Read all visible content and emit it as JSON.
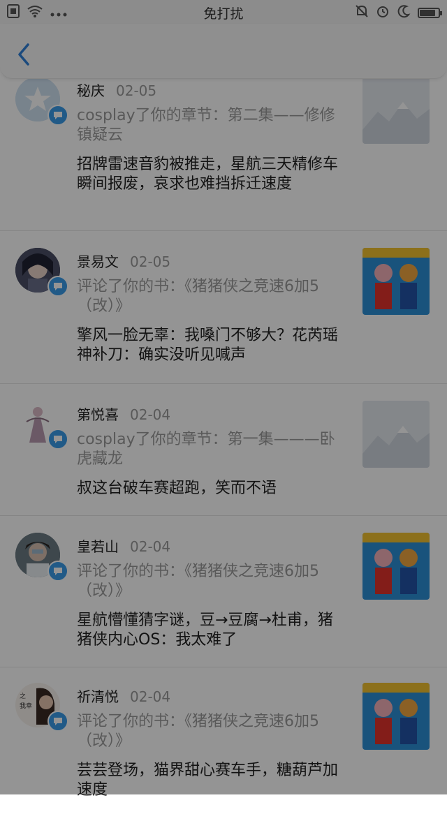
{
  "status_bar": {
    "center_text": "免打扰",
    "icons_left": [
      "sim-icon",
      "wifi-icon",
      "more-dots-icon"
    ],
    "icons_right": [
      "silent-bell-icon",
      "alarm-icon",
      "moon-icon",
      "battery-icon"
    ],
    "battery_level": 0.85
  },
  "header": {
    "back_icon": "chevron-left-icon",
    "accent": "#2f80d8"
  },
  "notifications": [
    {
      "name": "秘庆",
      "date": "02-05",
      "action": "cosplay了你的章节：第二集——修修镇疑云",
      "content": "招牌雷速音豹被推走，星航三天精修车瞬间报废，哀求也难挡拆迁速度",
      "thumb": "mountain-placeholder"
    },
    {
      "name": "景易文",
      "date": "02-05",
      "action": "评论了你的书：《猪猪侠之竞速6加5（改）》",
      "content": "擎风一脸无辜：我嗓门不够大？花芮瑶神补刀：确实没听见喊声",
      "thumb": "book-cover"
    },
    {
      "name": "第悦喜",
      "date": "02-04",
      "action": "cosplay了你的章节：第一集———卧虎藏龙",
      "content": "叔这台破车赛超跑，笑而不语",
      "thumb": "mountain-placeholder"
    },
    {
      "name": "皇若山",
      "date": "02-04",
      "action": "评论了你的书：《猪猪侠之竞速6加5（改）》",
      "content": "星航懵懂猜字谜，豆→豆腐→杜甫，猪猪侠内心OS：我太难了",
      "thumb": "book-cover"
    },
    {
      "name": "祈清悦",
      "date": "02-04",
      "action": "评论了你的书：《猪猪侠之竞速6加5（改）》",
      "content": "芸芸登场，猫界甜心赛车手，糖葫芦加速度",
      "thumb": "book-cover"
    }
  ]
}
